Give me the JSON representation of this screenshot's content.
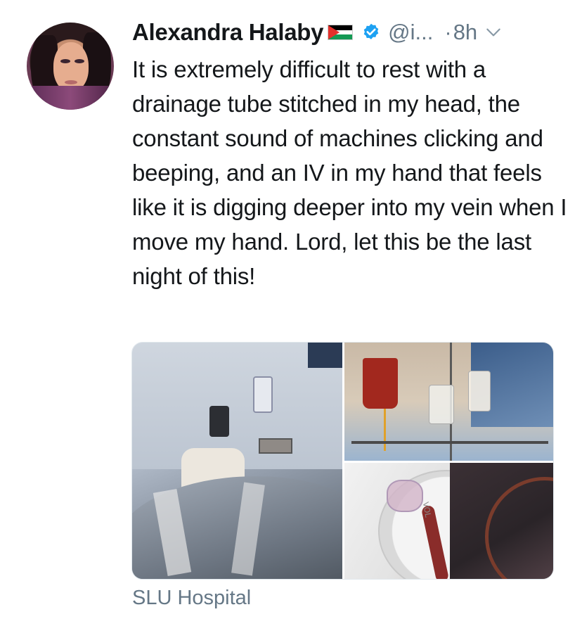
{
  "tweet": {
    "author_name": "Alexandra Halaby",
    "handle": "@i...",
    "separator": "·",
    "time": "8h",
    "text": "It is extremely difficult to rest with a drainage tube stitched in my head, the constant sound of machines clicking and beeping, and an IV in my hand that feels like it is digging deeper into my vein when I move my hand. Lord, let this be the last night of this!",
    "location": "SLU Hospital",
    "media": {
      "photo_1_label": "VOL",
      "photo_count": 3
    }
  },
  "icons": {
    "flag": "palestine-flag-icon",
    "verified": "verified-badge-icon",
    "more": "chevron-down-icon"
  },
  "colors": {
    "text_primary": "#14171a",
    "text_secondary": "#657786",
    "verified_blue": "#1da1f2",
    "border": "#e1e8ed"
  }
}
